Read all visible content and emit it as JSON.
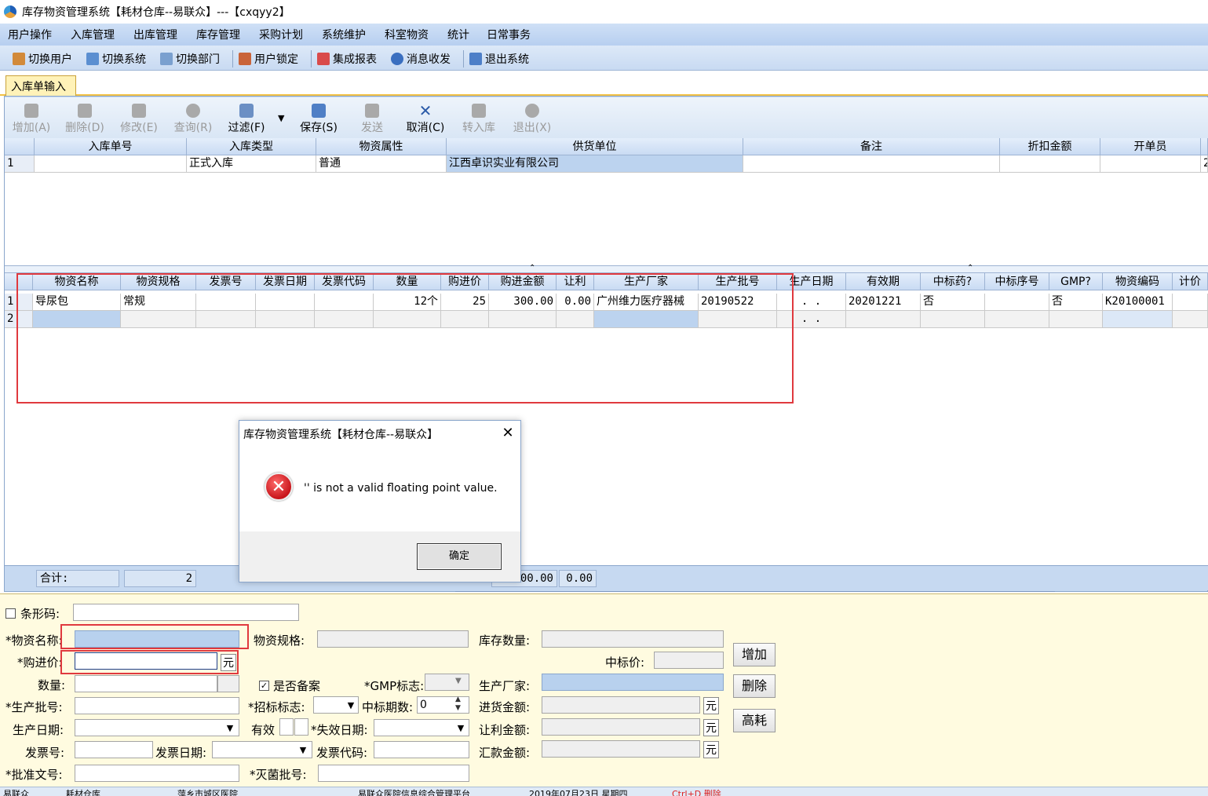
{
  "window": {
    "title": "库存物资管理系统【耗材仓库--易联众】---【cxqyy2】"
  },
  "menu": [
    "用户操作",
    "入库管理",
    "出库管理",
    "库存管理",
    "采购计划",
    "系统维护",
    "科室物资",
    "统计",
    "日常事务"
  ],
  "toolbar": [
    {
      "label": "切换用户",
      "icon": "users-icon"
    },
    {
      "label": "切换系统",
      "icon": "switch-system-icon"
    },
    {
      "label": "切换部门",
      "icon": "department-icon"
    },
    {
      "label": "用户锁定",
      "icon": "lock-user-icon"
    },
    {
      "label": "集成报表",
      "icon": "report-icon"
    },
    {
      "label": "消息收发",
      "icon": "info-icon"
    },
    {
      "label": "退出系统",
      "icon": "exit-icon"
    }
  ],
  "tab": {
    "active": "入库单输入"
  },
  "actions": [
    {
      "label": "增加(A)",
      "enabled": false
    },
    {
      "label": "删除(D)",
      "enabled": false
    },
    {
      "label": "修改(E)",
      "enabled": false
    },
    {
      "label": "查询(R)",
      "enabled": false
    },
    {
      "label": "过滤(F)",
      "enabled": true
    },
    {
      "label": "保存(S)",
      "enabled": true
    },
    {
      "label": "发送",
      "enabled": false
    },
    {
      "label": "取消(C)",
      "enabled": true
    },
    {
      "label": "转入库",
      "enabled": false
    },
    {
      "label": "退出(X)",
      "enabled": false
    }
  ],
  "grid1": {
    "headers": [
      "",
      "入库单号",
      "入库类型",
      "物资属性",
      "供货单位",
      "备注",
      "折扣金额",
      "开单员",
      ""
    ],
    "rows": [
      [
        "1",
        "",
        "正式入库",
        "普通",
        "江西卓识实业有限公司",
        "",
        "",
        "",
        "2"
      ]
    ]
  },
  "grid2": {
    "headers": [
      "",
      "物资名称",
      "物资规格",
      "发票号",
      "发票日期",
      "发票代码",
      "数量",
      "购进价",
      "购进金额",
      "让利",
      "生产厂家",
      "生产批号",
      "生产日期",
      "有效期",
      "中标药?",
      "中标序号",
      "GMP?",
      "物资编码",
      "计价"
    ],
    "rows": [
      [
        "1",
        "导尿包",
        "常规",
        "",
        "",
        "",
        "12个",
        "25",
        "300.00",
        "0.00",
        "广州维力医疗器械",
        "20190522",
        ". .",
        "20201221",
        "否",
        "",
        "否",
        "K20100001",
        ""
      ],
      [
        "2",
        "",
        "",
        "",
        "",
        "",
        "",
        "",
        "",
        "",
        "",
        "",
        ". .",
        "",
        "",
        "",
        "",
        "",
        ""
      ]
    ]
  },
  "totals": {
    "label": "合计:",
    "count": "2",
    "amount": "00.00",
    "discount": "0.00"
  },
  "form": {
    "barcode_label": "条形码:",
    "name_label": "*物资名称:",
    "spec_label": "物资规格:",
    "stock_qty_label": "库存数量:",
    "bid_price_label": "中标价:",
    "price_label": "*购进价:",
    "price_unit": "元",
    "qty_label": "数量:",
    "filing_label": "是否备案",
    "gmp_label": "*GMP标志:",
    "maker_label": "生产厂家:",
    "batch_label": "*生产批号:",
    "bid_flag_label": "*招标标志:",
    "bid_period_label": "中标期数:",
    "bid_period_value": "0",
    "purchase_amt_label": "进货金额:",
    "unit": "元",
    "mfg_date_label": "生产日期:",
    "valid_label": "有效",
    "expiry_label": "*失效日期:",
    "discount_amt_label": "让利金额:",
    "invoice_no_label": "发票号:",
    "invoice_date_label": "发票日期:",
    "invoice_code_label": "发票代码:",
    "remit_amt_label": "汇款金额:",
    "approval_label": "*批准文号:",
    "sterile_label": "*灭菌批号:",
    "btn_add": "增加",
    "btn_delete": "删除",
    "btn_high": "高耗"
  },
  "dialog": {
    "title": "库存物资管理系统【耗材仓库--易联众】",
    "message": "'' is not a valid floating point value.",
    "ok": "确定",
    "close": "✕"
  },
  "status": [
    "易联众",
    "耗材仓库",
    "萍乡市城区医院",
    "易联众医院信息综合管理平台",
    "2019年07月23日 星期四",
    "Ctrl+D 删除"
  ],
  "colors": {
    "menu_bg": "#b7cff0",
    "tab_active": "#fff2b8",
    "form_bg": "#fffbe0",
    "highlight": "#e0393e",
    "selected_cell": "#bcd3ef"
  }
}
